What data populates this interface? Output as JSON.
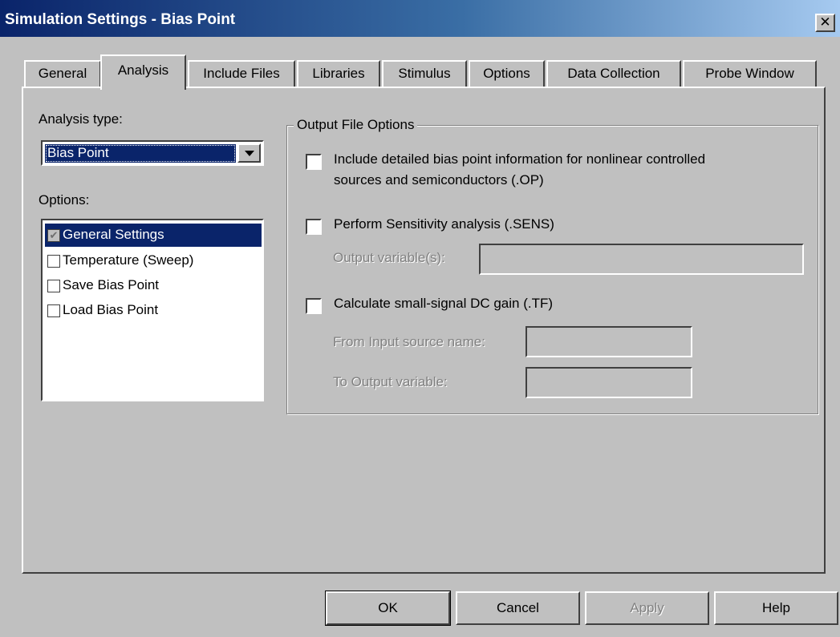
{
  "window": {
    "title": "Simulation Settings - Bias Point",
    "close": "✕"
  },
  "tabs": [
    {
      "label": "General"
    },
    {
      "label": "Analysis"
    },
    {
      "label": "Include Files"
    },
    {
      "label": "Libraries"
    },
    {
      "label": "Stimulus"
    },
    {
      "label": "Options"
    },
    {
      "label": "Data Collection"
    },
    {
      "label": "Probe Window"
    }
  ],
  "analysis_type": {
    "label": "Analysis type:",
    "value": "Bias Point"
  },
  "options": {
    "label": "Options:",
    "items": [
      {
        "label": "General Settings",
        "checked": "✔",
        "selected": true
      },
      {
        "label": "Temperature (Sweep)",
        "checked": "",
        "selected": false
      },
      {
        "label": "Save Bias Point",
        "checked": "",
        "selected": false
      },
      {
        "label": "Load Bias Point",
        "checked": "",
        "selected": false
      }
    ]
  },
  "output_file_options": {
    "title": "Output File Options",
    "op_label_line1": "Include detailed bias point information for nonlinear controlled",
    "op_label_line2": "sources and semiconductors (.OP)",
    "sens_label": "Perform Sensitivity analysis (.SENS)",
    "output_variables_label": "Output variable(s):",
    "output_variables_value": "",
    "tf_label": "Calculate small-signal DC gain (.TF)",
    "from_input_label": "From Input source name:",
    "from_input_value": "",
    "to_output_label": "To Output variable:",
    "to_output_value": ""
  },
  "buttons": {
    "ok": "OK",
    "cancel": "Cancel",
    "apply": "Apply",
    "help": "Help"
  }
}
